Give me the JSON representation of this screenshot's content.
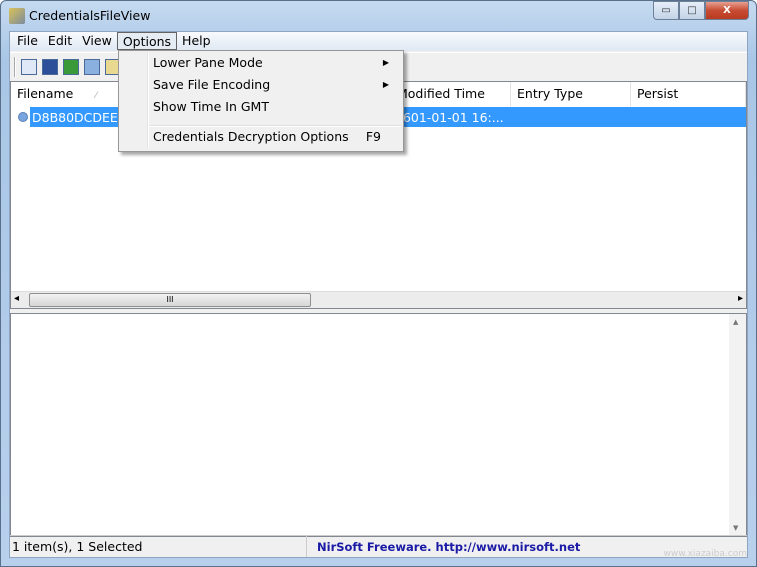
{
  "window": {
    "title": "CredentialsFileView",
    "minimize": "▭",
    "maximize": "□",
    "close": "X"
  },
  "menubar": [
    "File",
    "Edit",
    "View",
    "Options",
    "Help"
  ],
  "options_menu": {
    "items": [
      {
        "label": "Lower Pane Mode",
        "submenu": true
      },
      {
        "label": "Save File Encoding",
        "submenu": true
      },
      {
        "label": "Show Time In GMT"
      },
      {
        "label": "Credentials Decryption Options",
        "shortcut": "F9"
      }
    ]
  },
  "toolbar": {
    "icons": [
      "properties-icon",
      "save-icon",
      "refresh-icon",
      "copy-icon",
      "report-icon"
    ]
  },
  "list": {
    "columns": [
      "Filename",
      "Modified Time",
      "Entry Type",
      "Persist"
    ],
    "rows": [
      {
        "filename": "D8B80DCDEE",
        "modified": "1601-01-01 16:...",
        "modified_visible": "601-01-01 16:...",
        "entry_type": "",
        "persist": ""
      }
    ],
    "sort_indicator": "⁄"
  },
  "scroll": {
    "thumb_grip": "III",
    "up": "▲",
    "down": "▼",
    "left": "◂",
    "right": "▸"
  },
  "status": {
    "items": "1 item(s), 1 Selected",
    "credit": "NirSoft Freeware.  http://www.nirsoft.net"
  },
  "watermark": "www.xiazaiba.com",
  "colors": {
    "selection": "#3399ff",
    "credit": "#1a1aa6"
  }
}
